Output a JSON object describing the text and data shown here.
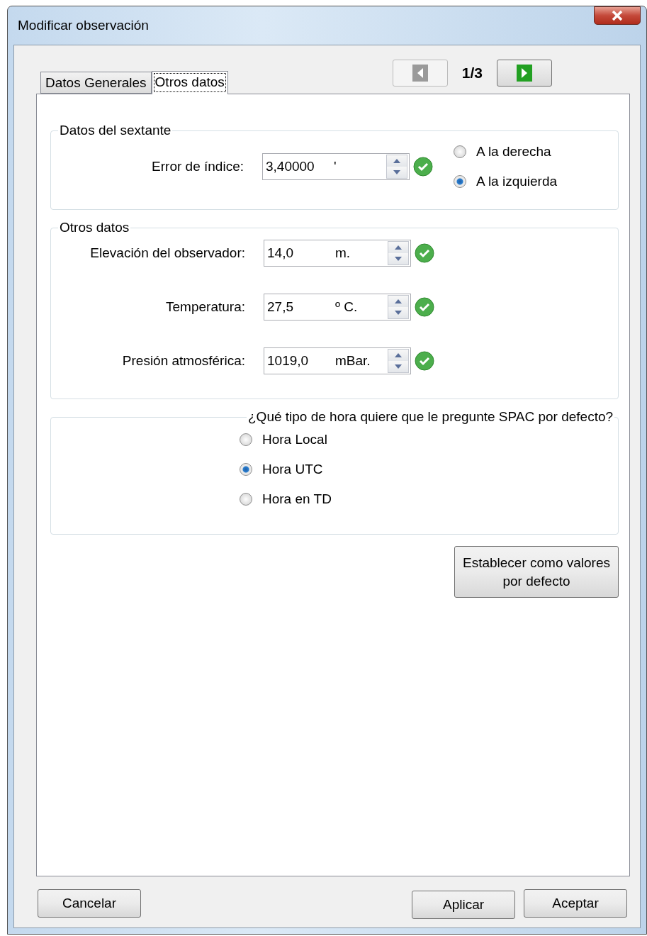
{
  "window": {
    "title": "Modificar observación"
  },
  "tabs": [
    {
      "label": "Datos Generales",
      "selected": false
    },
    {
      "label": "Otros datos",
      "selected": true
    }
  ],
  "pager": {
    "previous_disabled": true,
    "next_disabled": false,
    "position": "1/3"
  },
  "sextant": {
    "title": "Datos del sextante",
    "field": {
      "label": "Error de índice:",
      "value": "3,40000",
      "unit": "'",
      "valid": true
    },
    "options": [
      {
        "label": "A la derecha",
        "selected": false
      },
      {
        "label": "A la izquierda",
        "selected": true
      }
    ]
  },
  "other": {
    "title": "Otros datos",
    "fields": [
      {
        "label": "Elevación del observador:",
        "value": "14,0",
        "unit": "m.",
        "valid": true
      },
      {
        "label": "Temperatura:",
        "value": "27,5",
        "unit": "º C.",
        "valid": true
      },
      {
        "label": "Presión atmosférica:",
        "value": "1019,0",
        "unit": "mBar.",
        "valid": true
      }
    ]
  },
  "time_type": {
    "title": "¿Qué tipo de hora quiere que le pregunte SPAC por defecto?",
    "options": [
      {
        "label": "Hora Local",
        "selected": false
      },
      {
        "label": "Hora UTC",
        "selected": true
      },
      {
        "label": "Hora en TD",
        "selected": false
      }
    ]
  },
  "default_button": {
    "label": "Establecer como valores por defecto"
  },
  "buttons": {
    "cancel": "Cancelar",
    "apply": "Aplicar",
    "accept": "Aceptar"
  }
}
